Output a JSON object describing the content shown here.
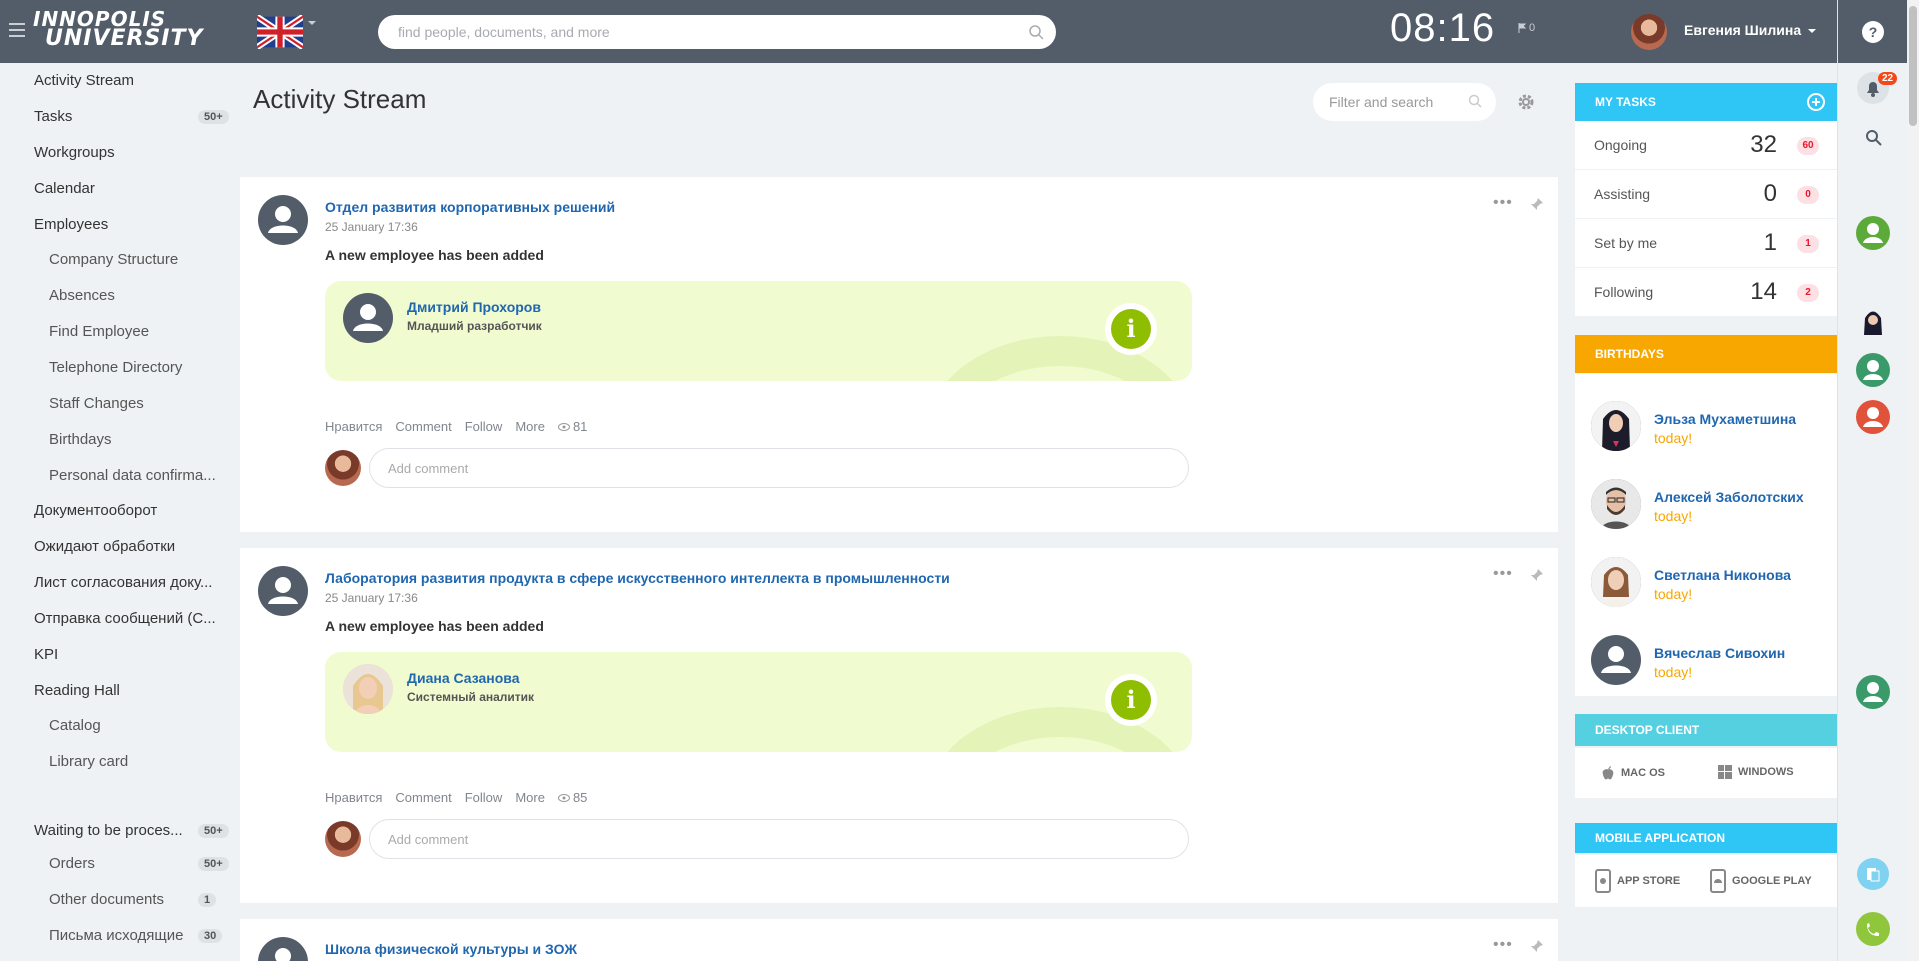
{
  "header": {
    "logo_line1": "INNOPOLIS",
    "logo_line2": "UNIVERSITY",
    "search_placeholder": "find people, documents, and more",
    "clock": "08:16",
    "flag_count": "0",
    "user_name": "Евгения Шилина"
  },
  "rightbar": {
    "notifications_count": "22"
  },
  "nav": {
    "items": [
      {
        "label": "Activity Stream"
      },
      {
        "label": "Tasks",
        "badge": "50+"
      },
      {
        "label": "Workgroups"
      },
      {
        "label": "Calendar"
      },
      {
        "label": "Employees"
      },
      {
        "label": "Company Structure"
      },
      {
        "label": "Absences"
      },
      {
        "label": "Find Employee"
      },
      {
        "label": "Telephone Directory"
      },
      {
        "label": "Staff Changes"
      },
      {
        "label": "Birthdays"
      },
      {
        "label": "Personal data confirma..."
      },
      {
        "label": "Документооборот"
      },
      {
        "label": "Ожидают обработки"
      },
      {
        "label": "Лист согласования доку..."
      },
      {
        "label": "Отправка сообщений (С..."
      },
      {
        "label": "KPI"
      },
      {
        "label": "Reading Hall"
      },
      {
        "label": "Catalog"
      },
      {
        "label": "Library card"
      },
      {
        "label": "Waiting to be proces...",
        "badge": "50+"
      },
      {
        "label": "Orders",
        "badge": "50+"
      },
      {
        "label": "Other documents",
        "badge": "1"
      },
      {
        "label": "Письма исходящие",
        "badge": "30"
      }
    ]
  },
  "main": {
    "title": "Activity Stream",
    "filter_placeholder": "Filter and search",
    "posts": [
      {
        "title": "Отдел развития корпоративных решений",
        "date": "25 January 17:36",
        "text": "A new employee has been added",
        "employee_name": "Дмитрий Прохоров",
        "employee_role": "Младший разработчик",
        "like": "Нравится",
        "comment": "Comment",
        "follow": "Follow",
        "more": "More",
        "views": "81",
        "comment_placeholder": "Add comment"
      },
      {
        "title": "Лаборатория развития продукта в сфере искусственного интеллекта в промышленности",
        "date": "25 January 17:36",
        "text": "A new employee has been added",
        "employee_name": "Диана Сазанова",
        "employee_role": "Системный аналитик",
        "like": "Нравится",
        "comment": "Comment",
        "follow": "Follow",
        "more": "More",
        "views": "85",
        "comment_placeholder": "Add comment"
      },
      {
        "title": "Школа физической культуры и ЗОЖ"
      }
    ]
  },
  "tasks": {
    "header": "MY TASKS",
    "rows": [
      {
        "label": "Ongoing",
        "count": "32",
        "badge": "60"
      },
      {
        "label": "Assisting",
        "count": "0",
        "badge": "0"
      },
      {
        "label": "Set by me",
        "count": "1",
        "badge": "1"
      },
      {
        "label": "Following",
        "count": "14",
        "badge": "2"
      }
    ]
  },
  "birthdays": {
    "header": "BIRTHDAYS",
    "people": [
      {
        "name": "Эльза Мухаметшина",
        "date": "today!"
      },
      {
        "name": "Алексей Заболотских",
        "date": "today!"
      },
      {
        "name": "Светлана Никонова",
        "date": "today!"
      },
      {
        "name": "Вячеслав Сивохин",
        "date": "today!"
      }
    ]
  },
  "desktop": {
    "header": "DESKTOP CLIENT",
    "mac": "MAC OS",
    "windows": "WINDOWS"
  },
  "mobile": {
    "header": "MOBILE APPLICATION",
    "appstore": "APP STORE",
    "googleplay": "GOOGLE PLAY"
  },
  "colors": {
    "header_bg": "#535c69",
    "link": "#2067b0",
    "tasks_header": "#2fc6f6",
    "birthdays_header": "#f7a700",
    "desktop_header": "#55d0e0",
    "mobile_header": "#2fc6f6",
    "info_green": "#8fbe00"
  }
}
